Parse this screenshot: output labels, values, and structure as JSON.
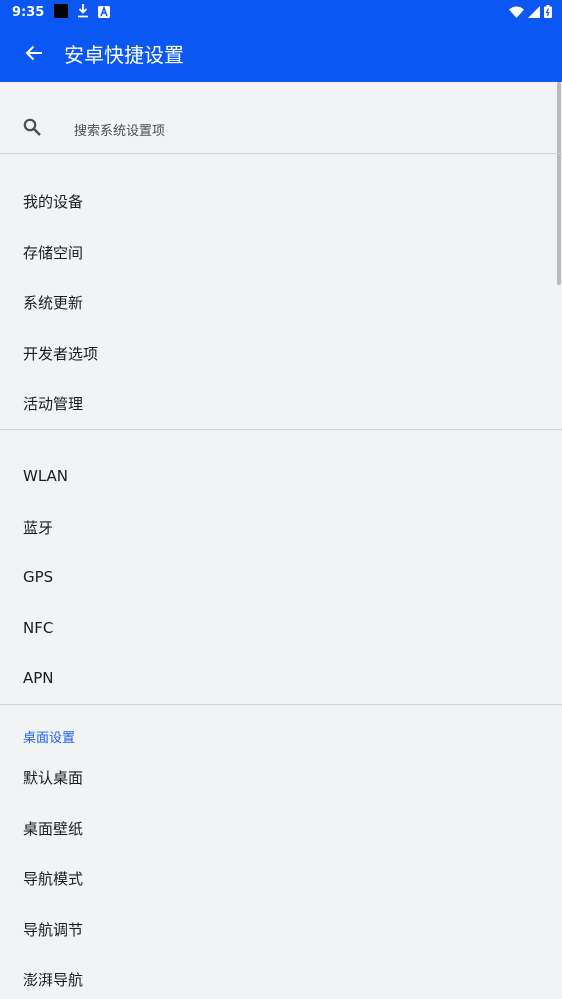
{
  "status_bar": {
    "time": "9:35"
  },
  "app_bar": {
    "title": "安卓快捷设置"
  },
  "search": {
    "placeholder": "搜索系统设置项"
  },
  "group1": [
    "我的设备",
    "存储空间",
    "系统更新",
    "开发者选项",
    "活动管理"
  ],
  "group2": [
    "WLAN",
    "蓝牙",
    "GPS",
    "NFC",
    "APN"
  ],
  "group3": {
    "header": "桌面设置",
    "items": [
      "默认桌面",
      "桌面壁纸",
      "导航模式",
      "导航调节",
      "澎湃导航"
    ]
  },
  "colors": {
    "primary": "#0b57f4",
    "background": "#f2f3f5",
    "accent": "#1f62f0"
  }
}
